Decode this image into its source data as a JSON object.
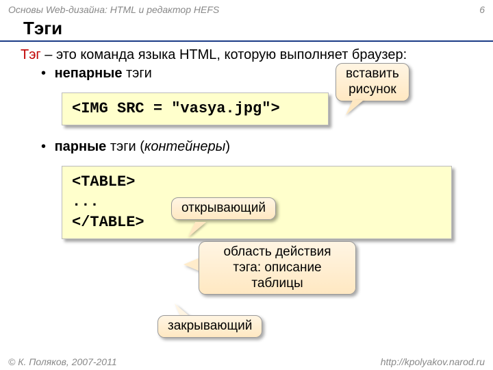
{
  "header": {
    "left": "Основы Web-дизайна: HTML и редактор HEFS",
    "pagenum": "6"
  },
  "title": "Тэги",
  "definition": {
    "term": "Тэг",
    "rest": " – это команда языка HTML, которую выполняет браузер:"
  },
  "bullets": {
    "b1_bold": "непарные",
    "b1_rest": " тэги",
    "b2_bold": "парные",
    "b2_rest": " тэги (",
    "b2_italic": "контейнеры",
    "b2_close": ")"
  },
  "code": {
    "c1": "<IMG SRC = \"vasya.jpg\">",
    "c2": "<TABLE>\n...\n</TABLE>"
  },
  "callouts": {
    "insert_image": "вставить\nрисунок",
    "opening": "открывающий",
    "scope": "область действия тэга: описание таблицы",
    "closing": "закрывающий"
  },
  "footer": {
    "left": "© К. Поляков, 2007-2011",
    "right": "http://kpolyakov.narod.ru"
  }
}
